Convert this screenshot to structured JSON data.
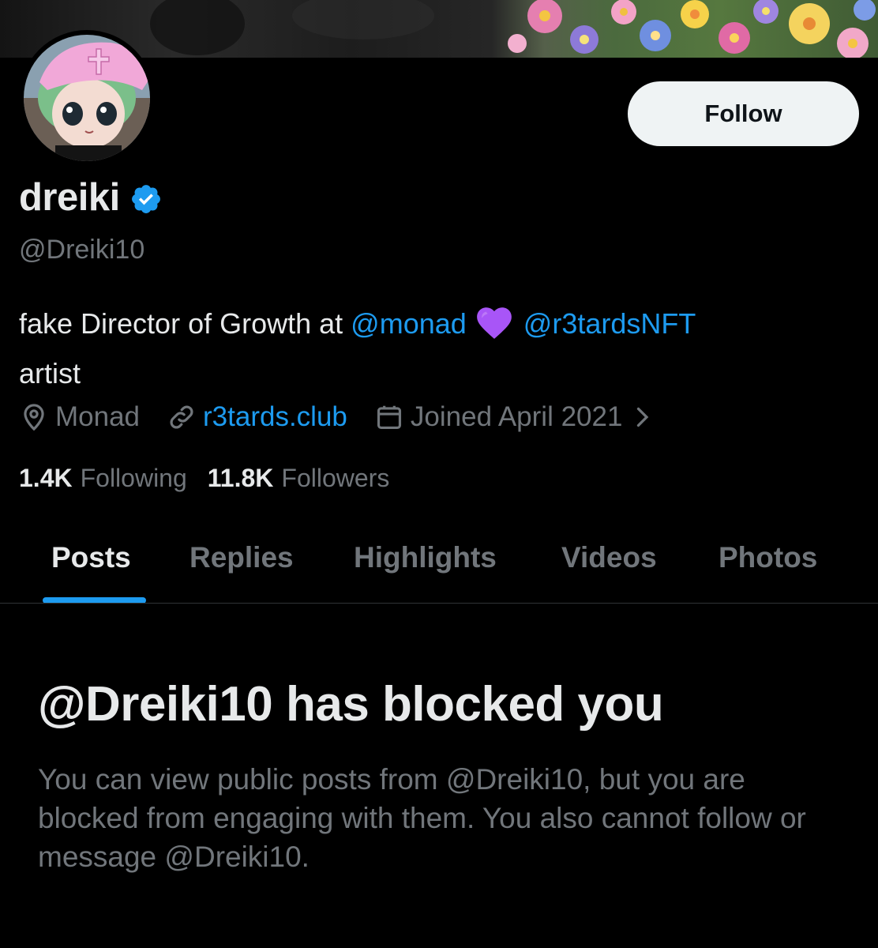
{
  "profile": {
    "display_name": "dreiki",
    "handle": "@Dreiki10",
    "verified": true,
    "follow_label": "Follow",
    "bio": {
      "prefix": "fake Director of Growth at ",
      "mention1": "@monad",
      "heart": "💜",
      "mention2": "@r3tardsNFT",
      "line2": "artist"
    },
    "meta": {
      "location": "Monad",
      "website": "r3tards.club",
      "joined": "Joined April 2021"
    },
    "counts": {
      "following_value": "1.4K",
      "following_label": "Following",
      "followers_value": "11.8K",
      "followers_label": "Followers"
    }
  },
  "tabs": [
    {
      "label": "Posts",
      "active": true
    },
    {
      "label": "Replies",
      "active": false
    },
    {
      "label": "Highlights",
      "active": false
    },
    {
      "label": "Videos",
      "active": false
    },
    {
      "label": "Photos",
      "active": false
    }
  ],
  "blocked": {
    "title": "@Dreiki10 has blocked you",
    "body": "You can view public posts from @Dreiki10, but you are blocked from engaging with them. You also cannot follow or message @Dreiki10."
  },
  "colors": {
    "background": "#000000",
    "accent": "#1d9bf0",
    "text_primary": "#e7e9ea",
    "text_secondary": "#71767b",
    "heart": "#a855f7"
  }
}
